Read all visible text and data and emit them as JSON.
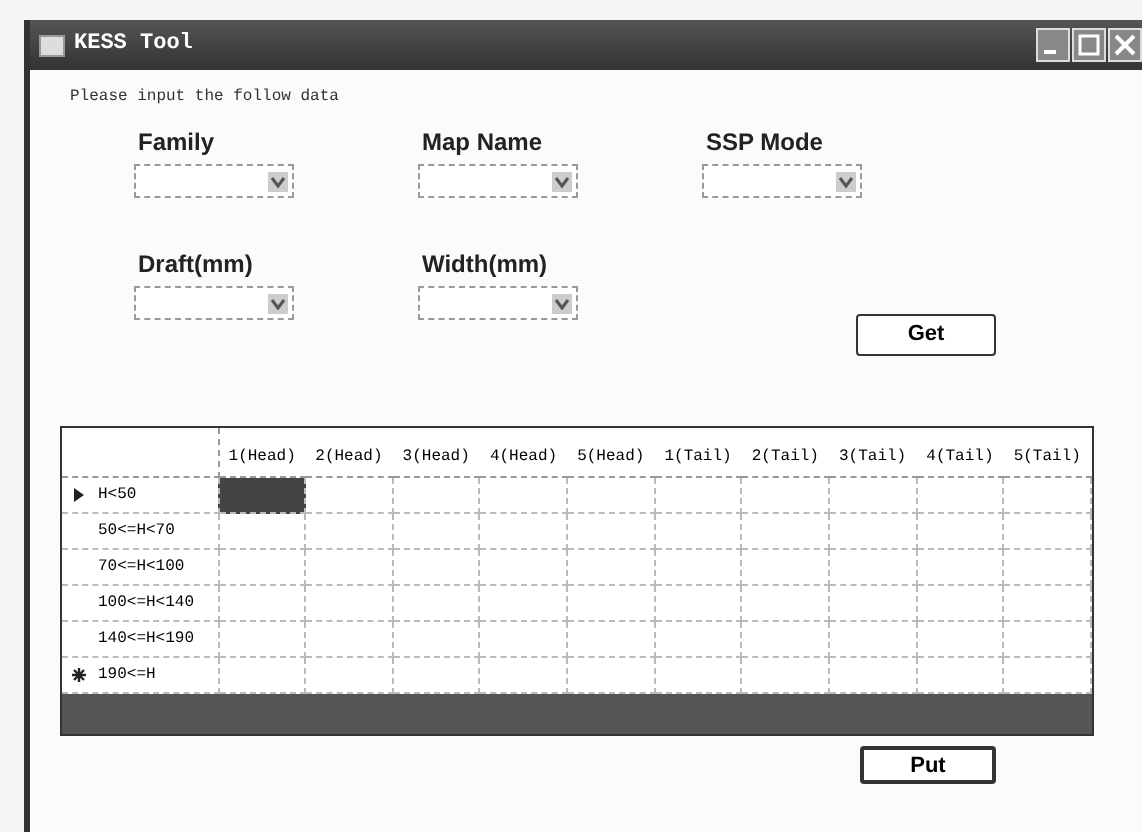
{
  "window": {
    "title": "KESS Tool"
  },
  "instruction": "Please input the follow data",
  "fields": [
    {
      "label": "Family"
    },
    {
      "label": "Map Name"
    },
    {
      "label": "SSP Mode"
    },
    {
      "label": "Draft(mm)"
    },
    {
      "label": "Width(mm)"
    }
  ],
  "get_button": "Get",
  "table": {
    "columns": [
      "1(Head)",
      "2(Head)",
      "3(Head)",
      "4(Head)",
      "5(Head)",
      "1(Tail)",
      "2(Tail)",
      "3(Tail)",
      "4(Tail)",
      "5(Tail)"
    ],
    "rows": [
      {
        "header": "H<50",
        "current": true,
        "new_row": false,
        "cells": [
          {
            "selected": true
          },
          {
            "selected": false
          },
          {
            "selected": false
          },
          {
            "selected": false
          },
          {
            "selected": false
          },
          {
            "selected": false
          },
          {
            "selected": false
          },
          {
            "selected": false
          },
          {
            "selected": false
          },
          {
            "selected": false
          }
        ]
      },
      {
        "header": "50<=H<70",
        "current": false,
        "new_row": false,
        "cells": [
          {
            "selected": false
          },
          {
            "selected": false
          },
          {
            "selected": false
          },
          {
            "selected": false
          },
          {
            "selected": false
          },
          {
            "selected": false
          },
          {
            "selected": false
          },
          {
            "selected": false
          },
          {
            "selected": false
          },
          {
            "selected": false
          }
        ]
      },
      {
        "header": "70<=H<100",
        "current": false,
        "new_row": false,
        "cells": [
          {
            "selected": false
          },
          {
            "selected": false
          },
          {
            "selected": false
          },
          {
            "selected": false
          },
          {
            "selected": false
          },
          {
            "selected": false
          },
          {
            "selected": false
          },
          {
            "selected": false
          },
          {
            "selected": false
          },
          {
            "selected": false
          }
        ]
      },
      {
        "header": "100<=H<140",
        "current": false,
        "new_row": false,
        "cells": [
          {
            "selected": false
          },
          {
            "selected": false
          },
          {
            "selected": false
          },
          {
            "selected": false
          },
          {
            "selected": false
          },
          {
            "selected": false
          },
          {
            "selected": false
          },
          {
            "selected": false
          },
          {
            "selected": false
          },
          {
            "selected": false
          }
        ]
      },
      {
        "header": "140<=H<190",
        "current": false,
        "new_row": false,
        "cells": [
          {
            "selected": false
          },
          {
            "selected": false
          },
          {
            "selected": false
          },
          {
            "selected": false
          },
          {
            "selected": false
          },
          {
            "selected": false
          },
          {
            "selected": false
          },
          {
            "selected": false
          },
          {
            "selected": false
          },
          {
            "selected": false
          }
        ]
      },
      {
        "header": "190<=H",
        "current": false,
        "new_row": true,
        "cells": [
          {
            "selected": false
          },
          {
            "selected": false
          },
          {
            "selected": false
          },
          {
            "selected": false
          },
          {
            "selected": false
          },
          {
            "selected": false
          },
          {
            "selected": false
          },
          {
            "selected": false
          },
          {
            "selected": false
          },
          {
            "selected": false
          }
        ]
      }
    ]
  },
  "put_button": "Put"
}
